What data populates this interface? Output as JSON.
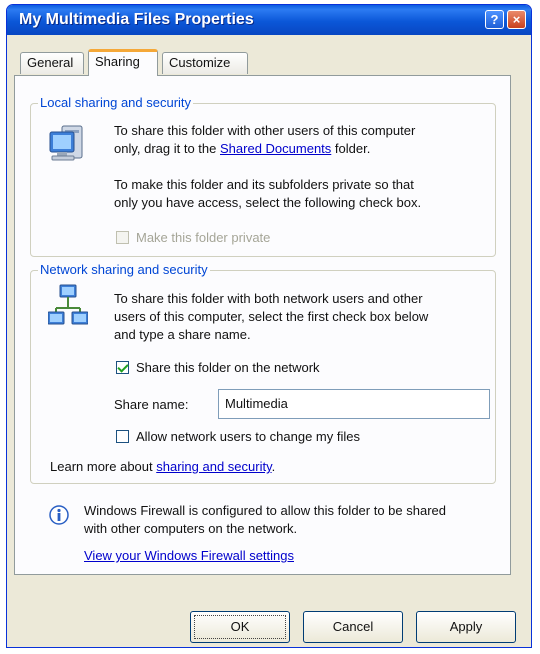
{
  "window": {
    "title": "My Multimedia Files Properties",
    "help_glyph": "?",
    "close_glyph": "×"
  },
  "tabs": [
    {
      "label": "General",
      "selected": false
    },
    {
      "label": "Sharing",
      "selected": true
    },
    {
      "label": "Customize",
      "selected": false
    }
  ],
  "local": {
    "legend": "Local sharing and security",
    "icon": "computer-icon",
    "text1_line1": "To share this folder with other users of this computer",
    "text1_pre": "only, drag it to the ",
    "text1_link": "Shared Documents",
    "text1_post": " folder.",
    "text2_line1": "To make this folder and its subfolders private so that",
    "text2_line2": "only you have access, select the following check box.",
    "private_label": "Make this folder private",
    "private_checked": false,
    "private_enabled": false
  },
  "network": {
    "legend": "Network sharing and security",
    "icon": "network-icon",
    "text_line1": "To share this folder with both network users and other",
    "text_line2": "users of this computer, select the first check box below",
    "text_line3": "and type a share name.",
    "share_label": "Share this folder on the network",
    "share_checked": true,
    "share_name_label": "Share name:",
    "share_name_value": "Multimedia",
    "allow_change_label": "Allow network users to change my files",
    "allow_change_checked": false,
    "learn_more_pre": "Learn more about ",
    "learn_more_link": "sharing and security",
    "learn_more_post": "."
  },
  "firewall": {
    "icon": "info-icon",
    "line1": "Windows Firewall is configured to allow this folder to be shared",
    "line2": "with other computers on the network.",
    "link": "View your Windows Firewall settings"
  },
  "buttons": {
    "ok": "OK",
    "cancel": "Cancel",
    "apply": "Apply"
  },
  "colors": {
    "title_bar": "#0b57d8",
    "dialog_bg": "#ece9d8",
    "group_legend": "#0046d5",
    "link": "#0000cc",
    "selected_tab_accent": "#f5a838"
  }
}
